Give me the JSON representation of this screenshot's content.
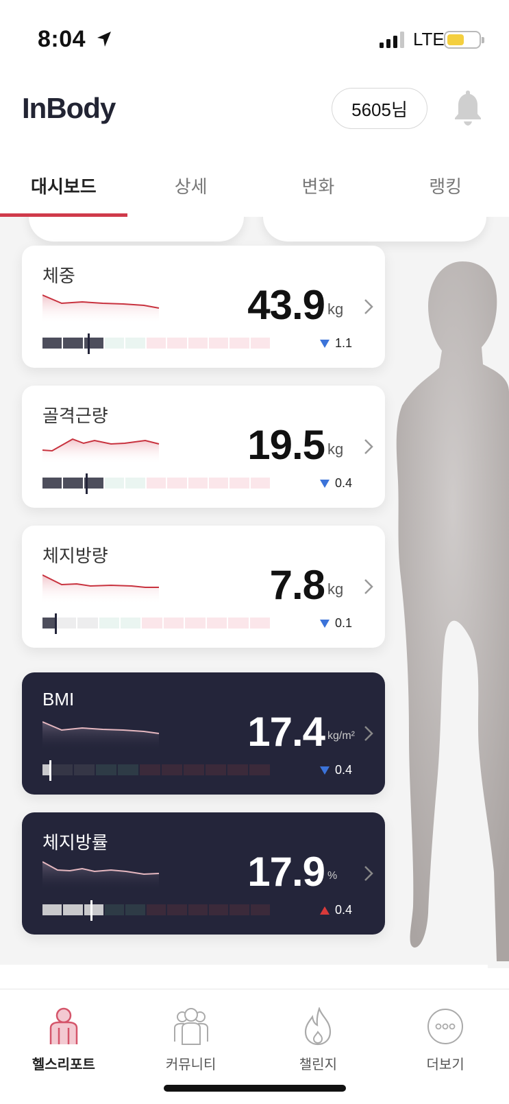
{
  "status_bar": {
    "time": "8:04",
    "network": "LTE"
  },
  "header": {
    "logo": "InBody",
    "user": "5605님"
  },
  "tabs": [
    {
      "label": "대시보드",
      "active": true
    },
    {
      "label": "상세",
      "active": false
    },
    {
      "label": "변화",
      "active": false
    },
    {
      "label": "랭킹",
      "active": false
    }
  ],
  "metrics": [
    {
      "label": "체중",
      "value": "43.9",
      "unit": "kg",
      "delta": "1.1",
      "direction": "down",
      "theme": "light",
      "marker_pct": 0.2
    },
    {
      "label": "골격근량",
      "value": "19.5",
      "unit": "kg",
      "delta": "0.4",
      "direction": "down",
      "theme": "light",
      "marker_pct": 0.19
    },
    {
      "label": "체지방량",
      "value": "7.8",
      "unit": "kg",
      "delta": "0.1",
      "direction": "down",
      "theme": "light",
      "marker_pct": 0.06
    },
    {
      "label": "BMI",
      "value": "17.4",
      "unit": "kg/m²",
      "delta": "0.4",
      "direction": "down",
      "theme": "dark",
      "marker_pct": 0.04
    },
    {
      "label": "체지방률",
      "value": "17.9",
      "unit": "%",
      "delta": "0.4",
      "direction": "up",
      "theme": "dark",
      "marker_pct": 0.22
    }
  ],
  "bottom_nav": [
    {
      "label": "헬스리포트",
      "icon": "health-report-icon",
      "active": true
    },
    {
      "label": "커뮤니티",
      "icon": "community-icon",
      "active": false
    },
    {
      "label": "챌린지",
      "icon": "flame-icon",
      "active": false
    },
    {
      "label": "더보기",
      "icon": "more-icon",
      "active": false
    }
  ],
  "colors": {
    "accent": "#cf3a4a",
    "dark_card": "#24253a",
    "delta_down": "#3b73d9",
    "delta_up": "#d93a3a"
  }
}
